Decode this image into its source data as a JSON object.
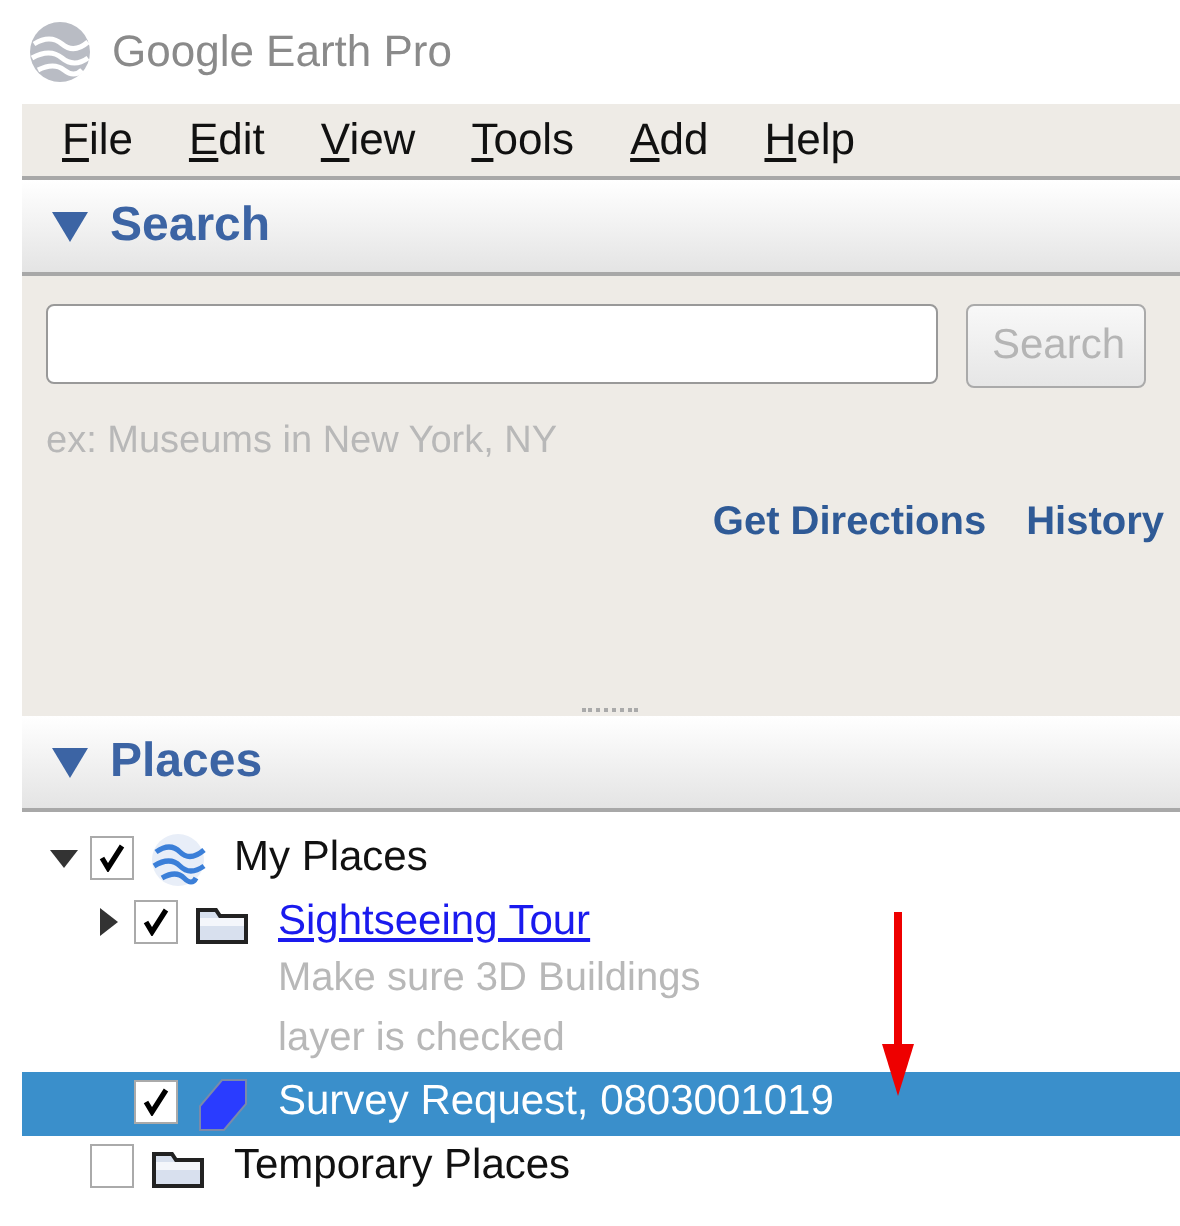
{
  "window": {
    "title": "Google Earth Pro"
  },
  "menu": [
    {
      "label": "File"
    },
    {
      "label": "Edit"
    },
    {
      "label": "View"
    },
    {
      "label": "Tools"
    },
    {
      "label": "Add"
    },
    {
      "label": "Help"
    }
  ],
  "search": {
    "header": {
      "title": "Search",
      "expanded": true
    },
    "button": {
      "label": "Search",
      "disabled": true
    },
    "hint": "ex: Museums in New York, NY",
    "links": [
      "Get Directions",
      "History"
    ]
  },
  "places": {
    "header": {
      "title": "Places",
      "expanded": true
    },
    "tree": [
      {
        "label": "My Places",
        "kind": "globe",
        "checked": true,
        "expanded": true,
        "selected": false,
        "children": [
          {
            "label": "Sightseeing Tour",
            "kind": "folder",
            "link": true,
            "checked": true,
            "expanded": false,
            "selected": false,
            "description": "Make sure 3D Buildings layer is checked"
          },
          {
            "label": "Survey Request, 0803001019",
            "kind": "polygon",
            "checked": true,
            "selected": true
          }
        ]
      },
      {
        "label": "Temporary Places",
        "kind": "folder",
        "checked": false,
        "selected": false
      }
    ]
  }
}
